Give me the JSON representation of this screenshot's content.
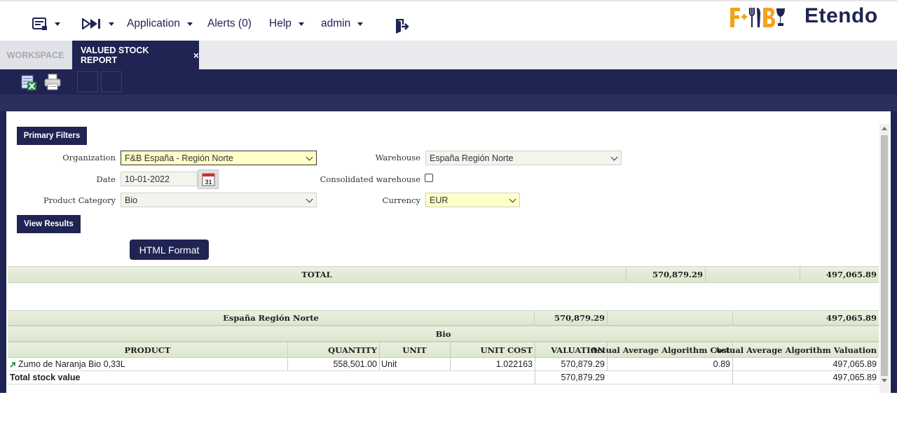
{
  "nav": {
    "menu_icon": "menu-list-icon",
    "quick_launch_icon": "quick-launch-icon",
    "application_label": "Application",
    "alerts_label": "Alerts (0)",
    "help_label": "Help",
    "user_label": "admin",
    "logout_icon": "logout-icon"
  },
  "brand": {
    "fb_logo_text": "F+B",
    "etendo_logo_text": "Etendo",
    "fb_color": "#f2a31b",
    "primary_color": "#202452"
  },
  "tabs": {
    "workspace_label": "WORKSPACE",
    "active_label": "VALUED STOCK REPORT",
    "close_glyph": "×"
  },
  "toolbar": {
    "export_icon": "export-spreadsheet-icon",
    "print_icon": "print-icon"
  },
  "filters": {
    "section_label": "Primary Filters",
    "organization_label": "Organization",
    "organization_value": "F&B España - Región Norte",
    "date_label": "Date",
    "date_value": "10-01-2022",
    "calendar_day": "31",
    "product_category_label": "Product Category",
    "product_category_value": "Bio",
    "warehouse_label": "Warehouse",
    "warehouse_value": "España Región Norte",
    "consolidated_label": "Consolidated warehouse",
    "currency_label": "Currency",
    "currency_value": "EUR",
    "view_results_label": "View Results",
    "html_format_label": "HTML Format"
  },
  "report": {
    "total_row": {
      "label": "TOTAL",
      "valuation": "570,879.29",
      "algorithm_valuation": "497,065.89"
    },
    "warehouse_row": {
      "label": "España Región Norte",
      "valuation": "570,879.29",
      "algorithm_valuation": "497,065.89"
    },
    "category_label": "Bio",
    "columns": {
      "product": "PRODUCT",
      "quantity": "QUANTITY",
      "unit": "UNIT",
      "unit_cost": "UNIT COST",
      "valuation": "VALUATION",
      "algorithm_cost": "Actual Average Algorithm Cost",
      "algorithm_valuation": "Actual Average Algorithm Valuation"
    },
    "rows": [
      {
        "product": "Zumo de Naranja Bio 0,33L",
        "quantity": "558,501.00",
        "unit": "Unit",
        "unit_cost": "1.022163",
        "valuation": "570,879.29",
        "algorithm_cost": "0.89",
        "algorithm_valuation": "497,065.89"
      }
    ],
    "footer": {
      "label": "Total stock value",
      "valuation": "570,879.29",
      "algorithm_valuation": "497,065.89"
    }
  }
}
